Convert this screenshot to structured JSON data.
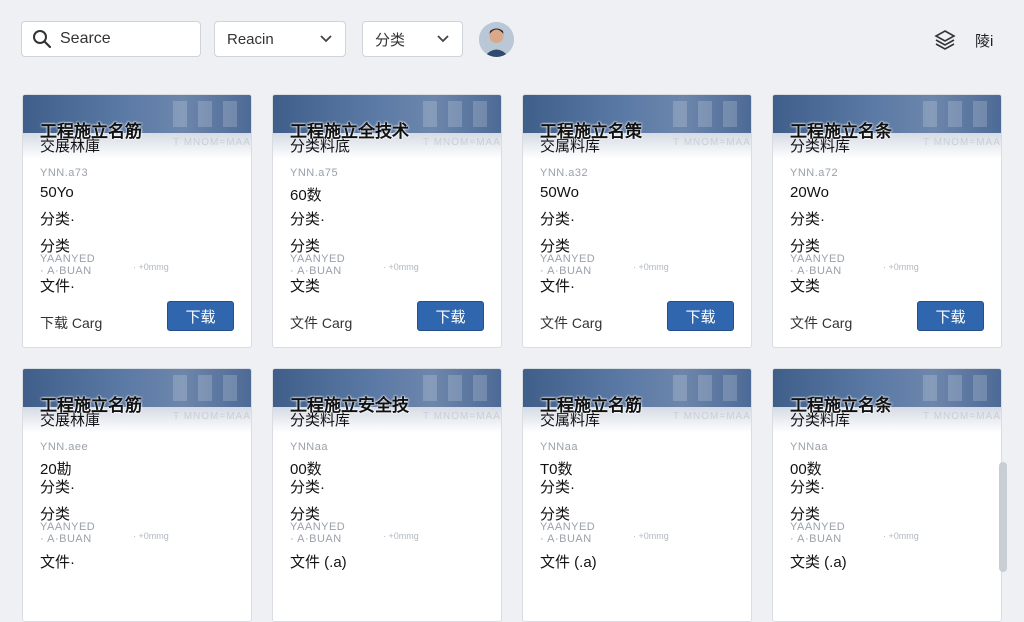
{
  "header": {
    "search_placeholder": "Searce",
    "select1_value": "Reacin",
    "select2_value": "分类",
    "right_label": "陵i"
  },
  "cards": [
    {
      "title": "工程施立名筋",
      "subtitle": "交展林庫",
      "faint1": "YNN.a73",
      "value": "50Yo",
      "line1": "分类·",
      "line2": "分类",
      "faint2": "YAANYED",
      "faint3": "· A·BUAN",
      "line3": "文件·",
      "footer": "下载 Carg",
      "button": "下载",
      "ghost": "T MNOM=MAAMN",
      "ghost2": "· +0mmg"
    },
    {
      "title": "工程施立全技术",
      "subtitle": "分类料底",
      "faint1": "YNN.a75",
      "value": "60数",
      "line1": "分类·",
      "line2": "分类",
      "faint2": "YAANYED",
      "faint3": "· A·BUAN",
      "line3": "文类",
      "footer": "文件 Carg",
      "button": "下载",
      "ghost": "T MNOM=MAAMN",
      "ghost2": "· +0mmg"
    },
    {
      "title": "工程施立名策",
      "subtitle": "交属料库",
      "faint1": "YNN.a32",
      "value": "50Wo",
      "line1": "分类·",
      "line2": "分类",
      "faint2": "YAANYED",
      "faint3": "· A·BUAN",
      "line3": "文件·",
      "footer": "文件 Carg",
      "button": "下载",
      "ghost": "T MNOM=MAAMN",
      "ghost2": "· +0mmg"
    },
    {
      "title": "工程施立名条",
      "subtitle": "分类料库",
      "faint1": "YNN.a72",
      "value": "20Wo",
      "line1": "分类·",
      "line2": "分类",
      "faint2": "YAANYED",
      "faint3": "· A·BUAN",
      "line3": "文类",
      "footer": "文件 Carg",
      "button": "下载",
      "ghost": "T MNOM=MAAMN",
      "ghost2": "· +0mmg"
    },
    {
      "title": "工程施立名筋",
      "subtitle": "交展林庫",
      "faint1": "YNN.aee",
      "value": "20勘",
      "line1": "分类·",
      "line2": "分类",
      "faint2": "YAANYED",
      "faint3": "· A·BUAN",
      "line3": "文件·",
      "footer": "",
      "button": "下载",
      "ghost": "T MNOM=MAAMN",
      "ghost2": "· +0mmg"
    },
    {
      "title": "工程施立安全技",
      "subtitle": "分类料库",
      "faint1": "YNNaa",
      "value": "00数",
      "line1": "分类·",
      "line2": "分类",
      "faint2": "YAANYED",
      "faint3": "· A·BUAN",
      "line3": "文件 (.a)",
      "footer": "",
      "button": "下载",
      "ghost": "T MNOM=MAAMN",
      "ghost2": "· +0mmg"
    },
    {
      "title": "工程施立名筋",
      "subtitle": "交属料库",
      "faint1": "YNNaa",
      "value": "T0数",
      "line1": "分类·",
      "line2": "分类",
      "faint2": "YAANYED",
      "faint3": "· A·BUAN",
      "line3": "文件 (.a)",
      "footer": "",
      "button": "下载",
      "ghost": "T MNOM=MAAMN",
      "ghost2": "· +0mmg"
    },
    {
      "title": "工程施立名条",
      "subtitle": "分类料库",
      "faint1": "YNNaa",
      "value": "00数",
      "line1": "分类·",
      "line2": "分类",
      "faint2": "YAANYED",
      "faint3": "· A·BUAN",
      "line3": "文类 (.a)",
      "footer": "",
      "button": "下载",
      "ghost": "T MNOM=MAAMN",
      "ghost2": "· +0mmg"
    }
  ],
  "colors": {
    "accent": "#2f66ad",
    "banner": "#4d6a96",
    "background": "#eef0f4"
  },
  "icons": {
    "search": "search-icon",
    "chevron": "chevron-down-icon",
    "stack": "layers-icon"
  }
}
